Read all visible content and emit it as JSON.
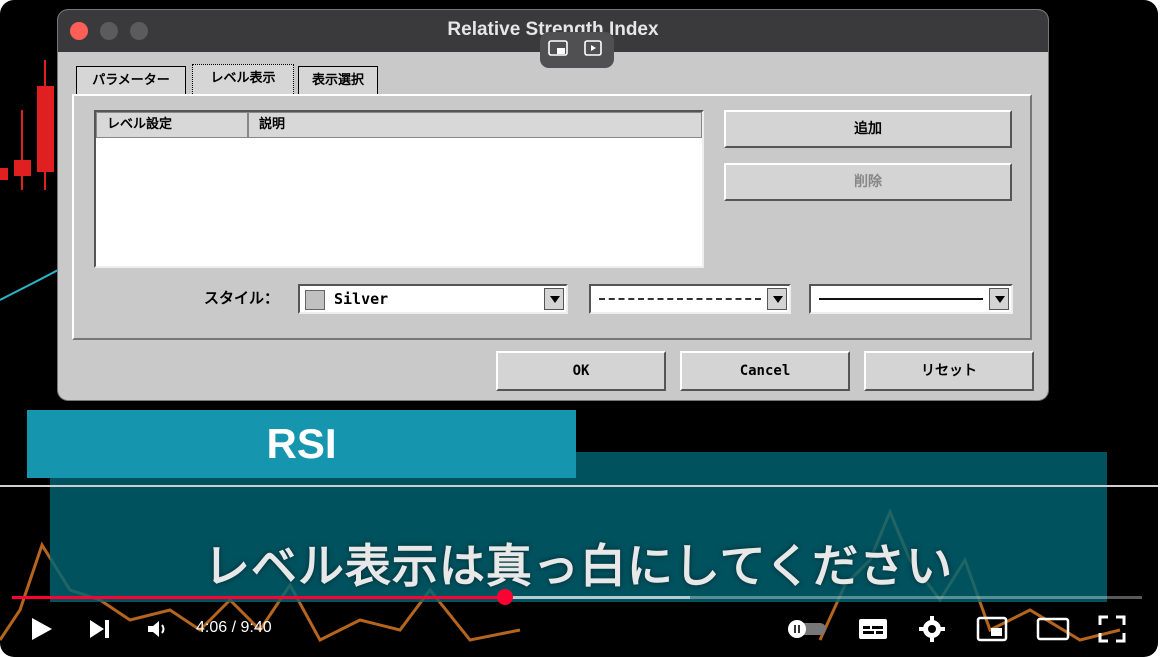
{
  "dialog": {
    "title": "Relative Strength Index",
    "tabs": [
      {
        "label": "パラメーター",
        "active": false
      },
      {
        "label": "レベル表示",
        "active": true
      },
      {
        "label": "表示選択",
        "active": false
      }
    ],
    "list_columns": [
      "レベル設定",
      "説明"
    ],
    "add_button": "追加",
    "delete_button": "削除",
    "style_label": "スタイル：",
    "color_value": "Silver",
    "color_swatch": "#c0c0c0",
    "ok_button": "OK",
    "cancel_button": "Cancel",
    "reset_button": "リセット"
  },
  "captions": {
    "heading": "RSI",
    "subtitle": "レベル表示は真っ白にしてください"
  },
  "player": {
    "time_display": "4:06 / 9:40",
    "progress_fraction": 0.4362,
    "buffered_fraction": 0.6,
    "accent_color": "#ff0033",
    "icons": [
      "play-icon",
      "next-icon",
      "volume-icon",
      "autoplay-toggle-icon",
      "subtitles-icon",
      "settings-icon",
      "miniplayer-icon",
      "theater-icon",
      "fullscreen-icon"
    ]
  }
}
